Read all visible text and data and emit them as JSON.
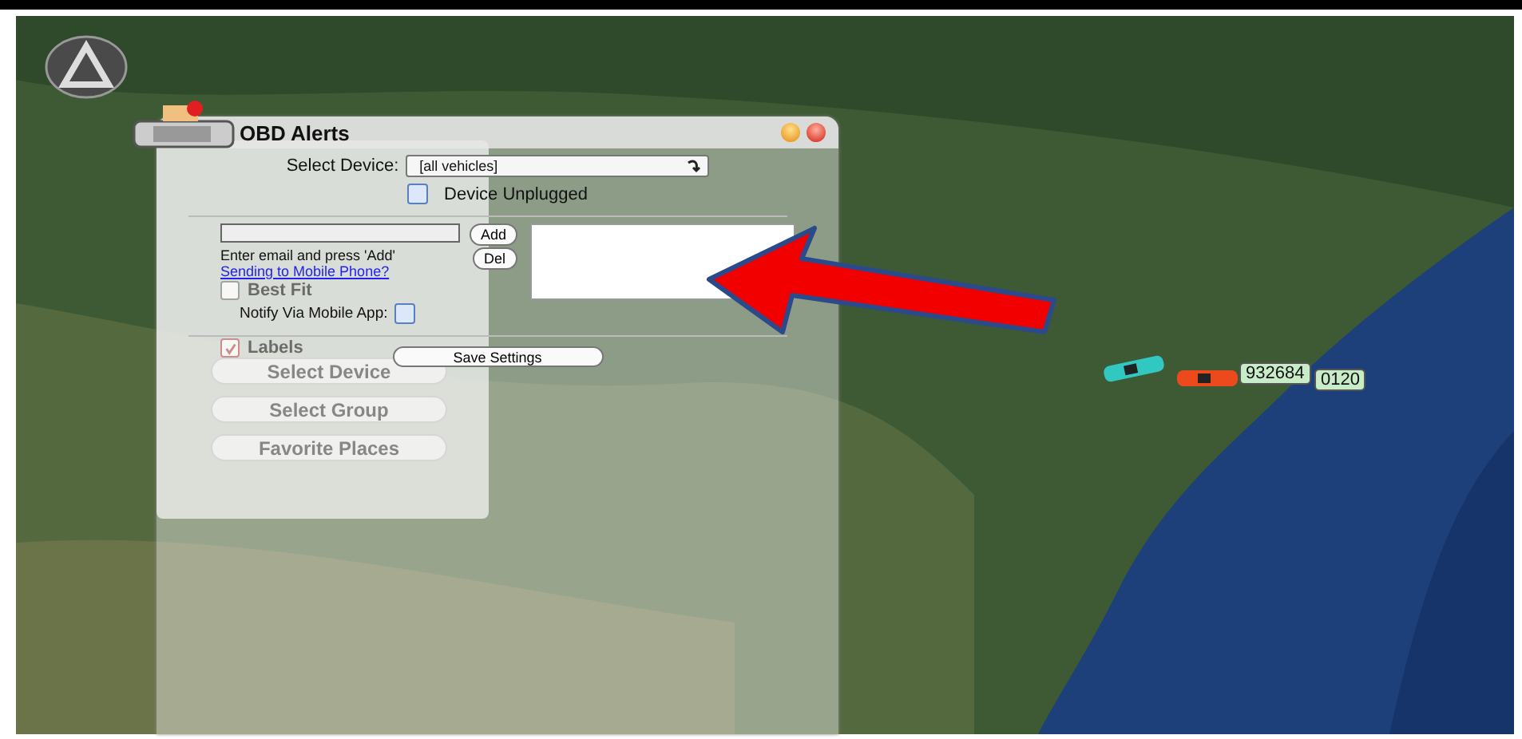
{
  "back_panel": {
    "toggles": [
      {
        "label": "Best Fit",
        "checked": false
      },
      {
        "label": "Labels",
        "checked": true
      }
    ],
    "buttons": [
      "Select Device",
      "Select Group",
      "Favorite Places"
    ]
  },
  "dialog": {
    "title": "OBD Alerts",
    "device_label": "Select Device:",
    "device_value": "[all vehicles]",
    "unplugged": {
      "label": "Device Unplugged",
      "checked": false
    },
    "email": {
      "hint": "Enter email and press 'Add'",
      "link": "Sending to Mobile Phone?",
      "add": "Add",
      "del": "Del"
    },
    "notify": {
      "label": "Notify Via Mobile App:",
      "checked": false
    },
    "save": "Save Settings"
  },
  "vehicles": [
    {
      "label": "932684",
      "color": "#30c8c0"
    },
    {
      "label": "0120",
      "color": "#ec4a1c"
    }
  ]
}
